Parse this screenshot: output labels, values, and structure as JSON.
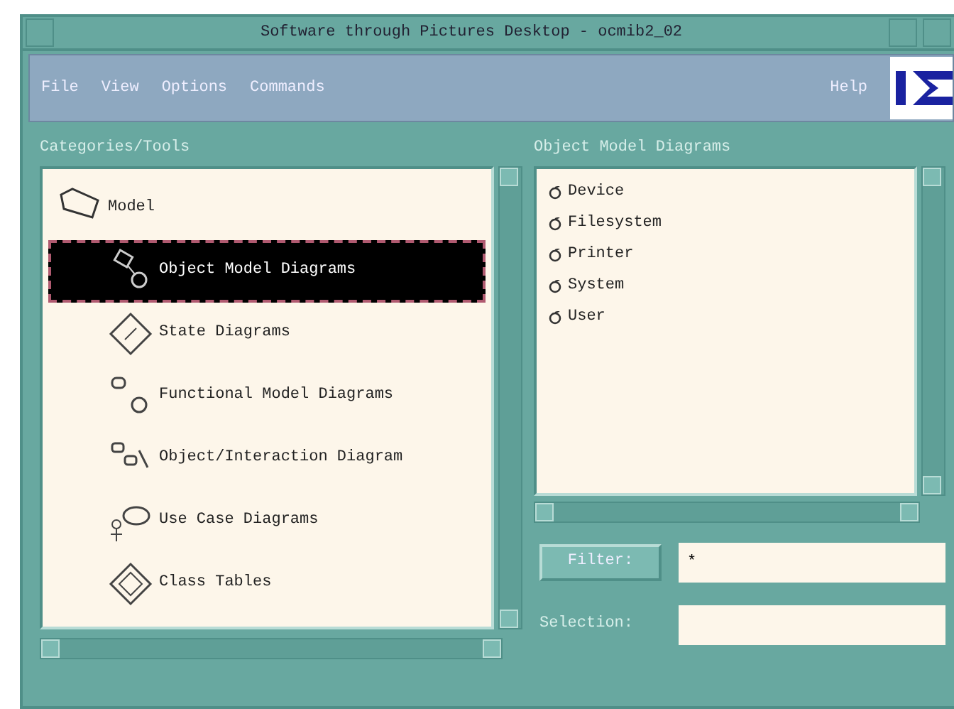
{
  "window": {
    "title": "Software through Pictures Desktop - ocmib2_02"
  },
  "menu": {
    "items": [
      {
        "label": "File"
      },
      {
        "label": "View"
      },
      {
        "label": "Options"
      },
      {
        "label": "Commands"
      }
    ],
    "help": "Help"
  },
  "categories": {
    "label": "Categories/Tools",
    "tree": [
      {
        "label": "Model",
        "children": [
          {
            "label": "Object Model Diagrams",
            "selected": true
          },
          {
            "label": "State Diagrams",
            "selected": false
          },
          {
            "label": "Functional Model Diagrams",
            "selected": false
          },
          {
            "label": "Object/Interaction Diagram",
            "selected": false
          },
          {
            "label": "Use Case Diagrams",
            "selected": false
          },
          {
            "label": "Class Tables",
            "selected": false
          }
        ]
      }
    ]
  },
  "objects": {
    "label": "Object Model Diagrams",
    "items": [
      "Device",
      "Filesystem",
      "Printer",
      "System",
      "User"
    ]
  },
  "filter": {
    "button": "Filter:",
    "value": "*"
  },
  "selection": {
    "label": "Selection:"
  }
}
